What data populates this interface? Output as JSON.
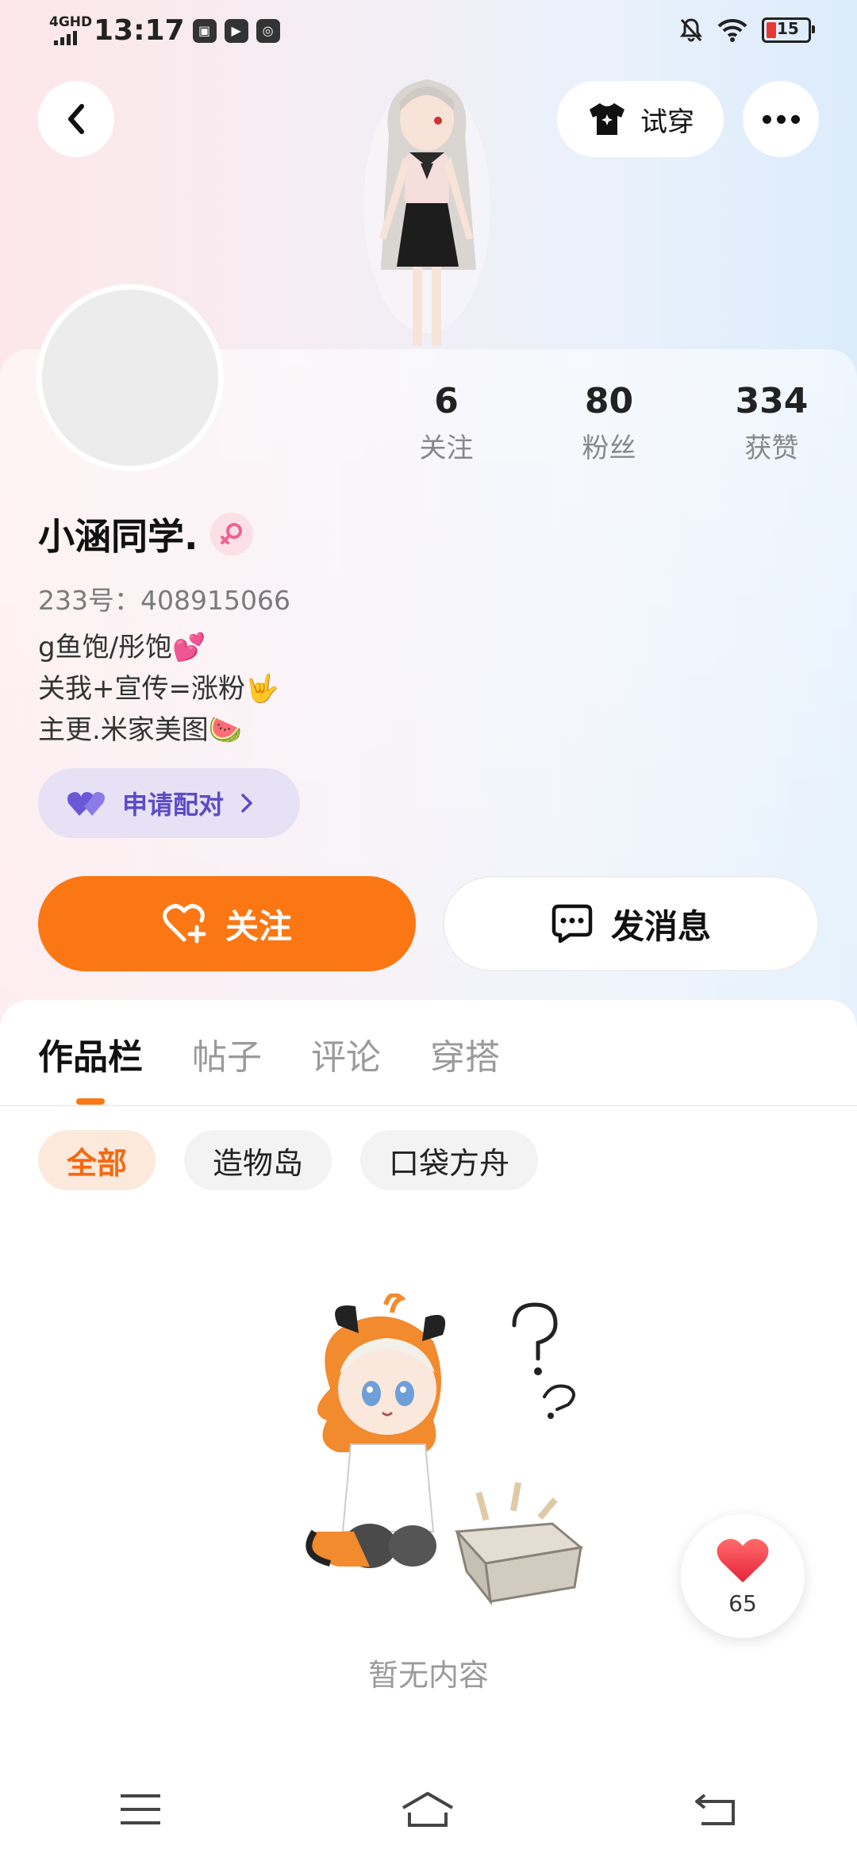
{
  "status_bar": {
    "network": "4GHD",
    "time": "13:17",
    "battery_level": "15",
    "battery_color": "#e53935",
    "app_icons": [
      "gamepad-icon",
      "play-icon",
      "chat-app-icon"
    ],
    "right_icons": [
      "mute-bell-icon",
      "wifi-icon",
      "battery-icon"
    ]
  },
  "top_bar": {
    "try_on_label": "试穿"
  },
  "profile": {
    "stats": [
      {
        "value": "6",
        "label": "关注"
      },
      {
        "value": "80",
        "label": "粉丝"
      },
      {
        "value": "334",
        "label": "获赞"
      }
    ],
    "nickname": "小涵同学.",
    "gender_icon": "female-icon",
    "uid": "233号：408915066",
    "bio_lines": [
      "g鱼饱/彤饱💕",
      "关我+宣传=涨粉🤟",
      "主更.米家美图🍉"
    ],
    "match_button": "申请配对"
  },
  "actions": {
    "follow_label": "关注",
    "message_label": "发消息"
  },
  "content": {
    "tabs": [
      "作品栏",
      "帖子",
      "评论",
      "穿搭"
    ],
    "active_tab": "作品栏",
    "filters": [
      "全部",
      "造物岛",
      "口袋方舟"
    ],
    "active_filter": "全部",
    "empty_text": "暂无内容"
  },
  "floating_like": {
    "count": "65"
  },
  "colors": {
    "accent": "#fb7713",
    "match_purple": "#5c4bc4"
  }
}
